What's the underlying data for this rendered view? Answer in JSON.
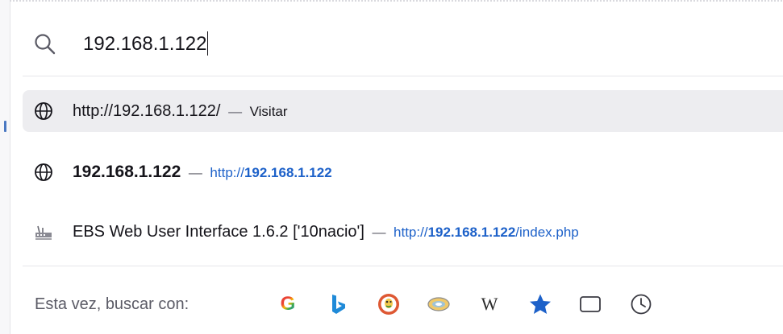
{
  "urlbar": {
    "value": "192.168.1.122",
    "icon": "search-icon"
  },
  "suggestions": [
    {
      "icon": "globe-icon",
      "url": "http://192.168.1.122/",
      "dash": "—",
      "action": "Visitar",
      "selected": true
    },
    {
      "icon": "globe-icon",
      "title": "192.168.1.122",
      "dash": "—",
      "link_prefix": "http://",
      "link_bold": "192.168.1.122"
    },
    {
      "icon": "router-icon",
      "title": "EBS Web User Interface 1.6.2 ['10nacio']",
      "dash": "—",
      "link_prefix": "http://",
      "link_bold": "192.168.1.122",
      "link_suffix": "/index.php"
    }
  ],
  "search_with": {
    "label": "Esta vez, buscar con:",
    "engines": [
      {
        "name": "google",
        "icon": "google-icon",
        "glyph": "G"
      },
      {
        "name": "bing",
        "icon": "bing-icon"
      },
      {
        "name": "duckduckgo",
        "icon": "duckduckgo-icon"
      },
      {
        "name": "ecosia",
        "icon": "ecosia-icon"
      },
      {
        "name": "wikipedia",
        "icon": "wikipedia-icon",
        "glyph": "W"
      },
      {
        "name": "bookmarks",
        "icon": "star-icon"
      },
      {
        "name": "tabs",
        "icon": "tab-icon"
      },
      {
        "name": "history",
        "icon": "clock-icon"
      }
    ]
  },
  "colors": {
    "link": "#1d61c9",
    "selected_bg": "#ededf0",
    "muted_text": "#5b5b66"
  }
}
